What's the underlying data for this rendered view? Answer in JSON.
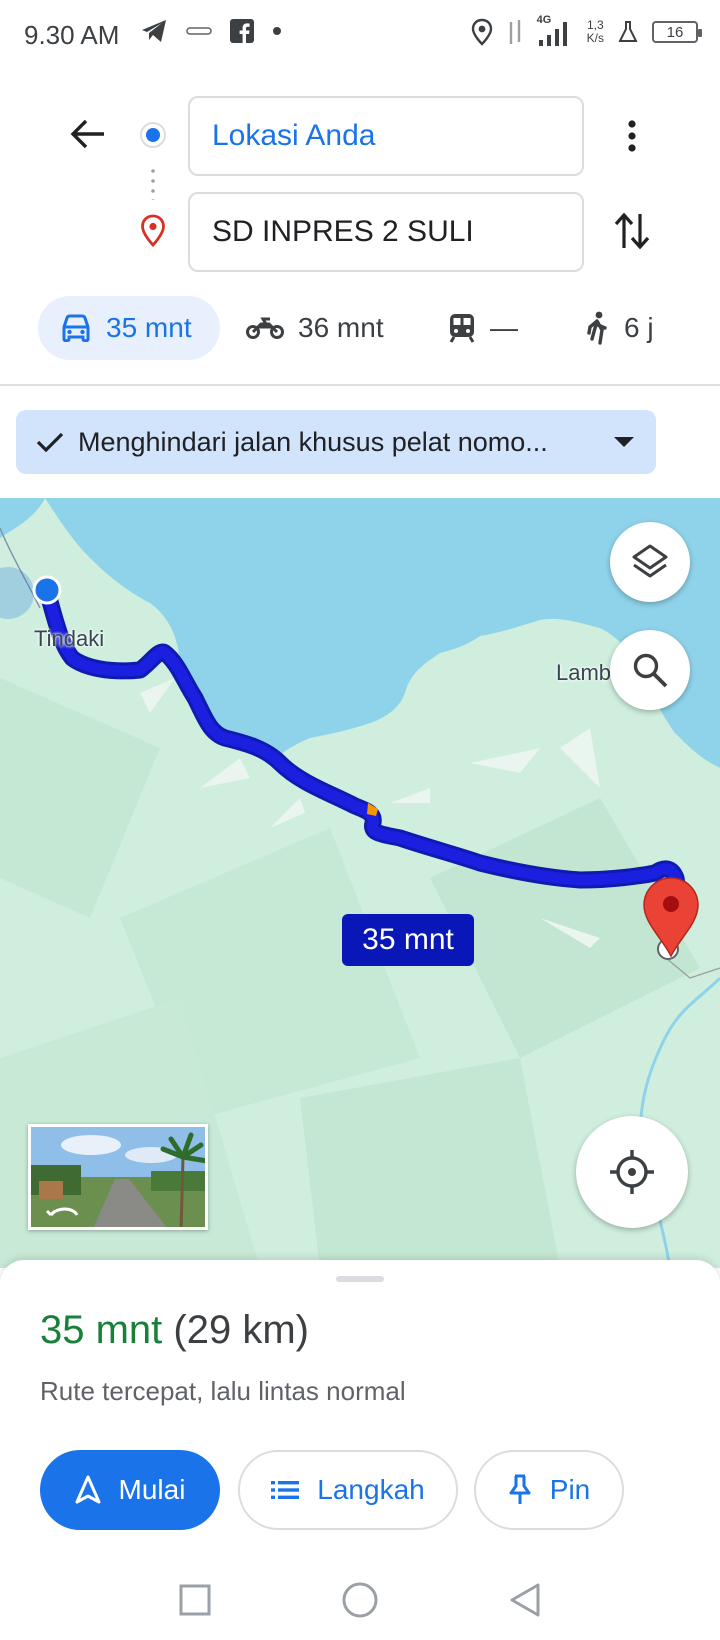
{
  "status_bar": {
    "time": "9.30 AM",
    "network": "4G",
    "speed_value": "1,3",
    "speed_unit": "K/s",
    "battery": "16"
  },
  "directions": {
    "origin_value": "Lokasi Anda",
    "destination_value": "SD INPRES 2 SULI"
  },
  "travel_modes": [
    {
      "icon": "car-icon",
      "label": "35 mnt",
      "selected": true
    },
    {
      "icon": "motorcycle-icon",
      "label": "36 mnt",
      "selected": false
    },
    {
      "icon": "transit-icon",
      "label": "—",
      "selected": false
    },
    {
      "icon": "walk-icon",
      "label": "6 j",
      "selected": false
    }
  ],
  "filter_chip": {
    "label": "Menghindari jalan khusus pelat nomo..."
  },
  "map": {
    "places": {
      "tindaki": "Tindaki",
      "lambage": "Lambage"
    },
    "route_eta": "35 mnt",
    "colors": {
      "water": "#8fd3ea",
      "land": "#cfeedd",
      "route": "#1a1fe0",
      "destination_pin": "#ea4335"
    }
  },
  "sheet": {
    "time": "35 mnt",
    "distance": "(29 km)",
    "description": "Rute tercepat, lalu lintas normal",
    "start_label": "Mulai",
    "steps_label": "Langkah",
    "pin_label": "Pin"
  },
  "accent": "#1a73e8"
}
